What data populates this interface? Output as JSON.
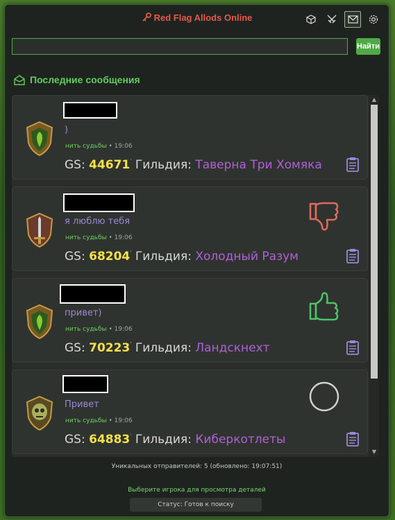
{
  "app": {
    "title": "Red Flag Allods Online"
  },
  "toolbar": {
    "icons": [
      "cube-icon",
      "swords-icon",
      "mail-icon",
      "gear-icon"
    ],
    "active": "mail-icon"
  },
  "search": {
    "value": "",
    "placeholder": "",
    "button_label": "Найти"
  },
  "section": {
    "title": "Последние сообщения"
  },
  "messages": [
    {
      "message": ")",
      "link_label": "нить судьбы",
      "time": "19:06",
      "gs_label": "GS:",
      "gs_value": "44671",
      "guild_label": "Гильдия:",
      "guild": "Таверна Три Хомяка",
      "avatar": "shield-leaf-icon",
      "reaction": "none"
    },
    {
      "message": "я люблю тебя",
      "link_label": "нить судьбы",
      "time": "19:06",
      "gs_label": "GS:",
      "gs_value": "68204",
      "guild_label": "Гильдия:",
      "guild": "Холодный Разум",
      "avatar": "shield-sword-icon",
      "reaction": "thumbs-down-icon"
    },
    {
      "message": "привет)",
      "link_label": "нить судьбы",
      "time": "19:06",
      "gs_label": "GS:",
      "gs_value": "70223",
      "guild_label": "Гильдия:",
      "guild": "Ландскнехт",
      "avatar": "shield-leaf-icon",
      "reaction": "thumbs-up-icon"
    },
    {
      "message": "Привет",
      "link_label": "нить судьбы",
      "time": "19:06",
      "gs_label": "GS:",
      "gs_value": "64883",
      "guild_label": "Гильдия:",
      "guild": "Киберкотлеты",
      "avatar": "shield-skull-icon",
      "reaction": "circle-icon"
    }
  ],
  "footer": {
    "unique_senders": "Уникальных отправителей: 5 (обновлено: 19:07:51)",
    "hint": "Выберите игрока для просмотра деталей",
    "status": "Статус: Готов к поиску"
  },
  "colors": {
    "accent": "#4faa46",
    "title": "#e35a4b",
    "gs": "#f5e04b",
    "guild": "#b060d8",
    "message": "#9a88d8"
  }
}
